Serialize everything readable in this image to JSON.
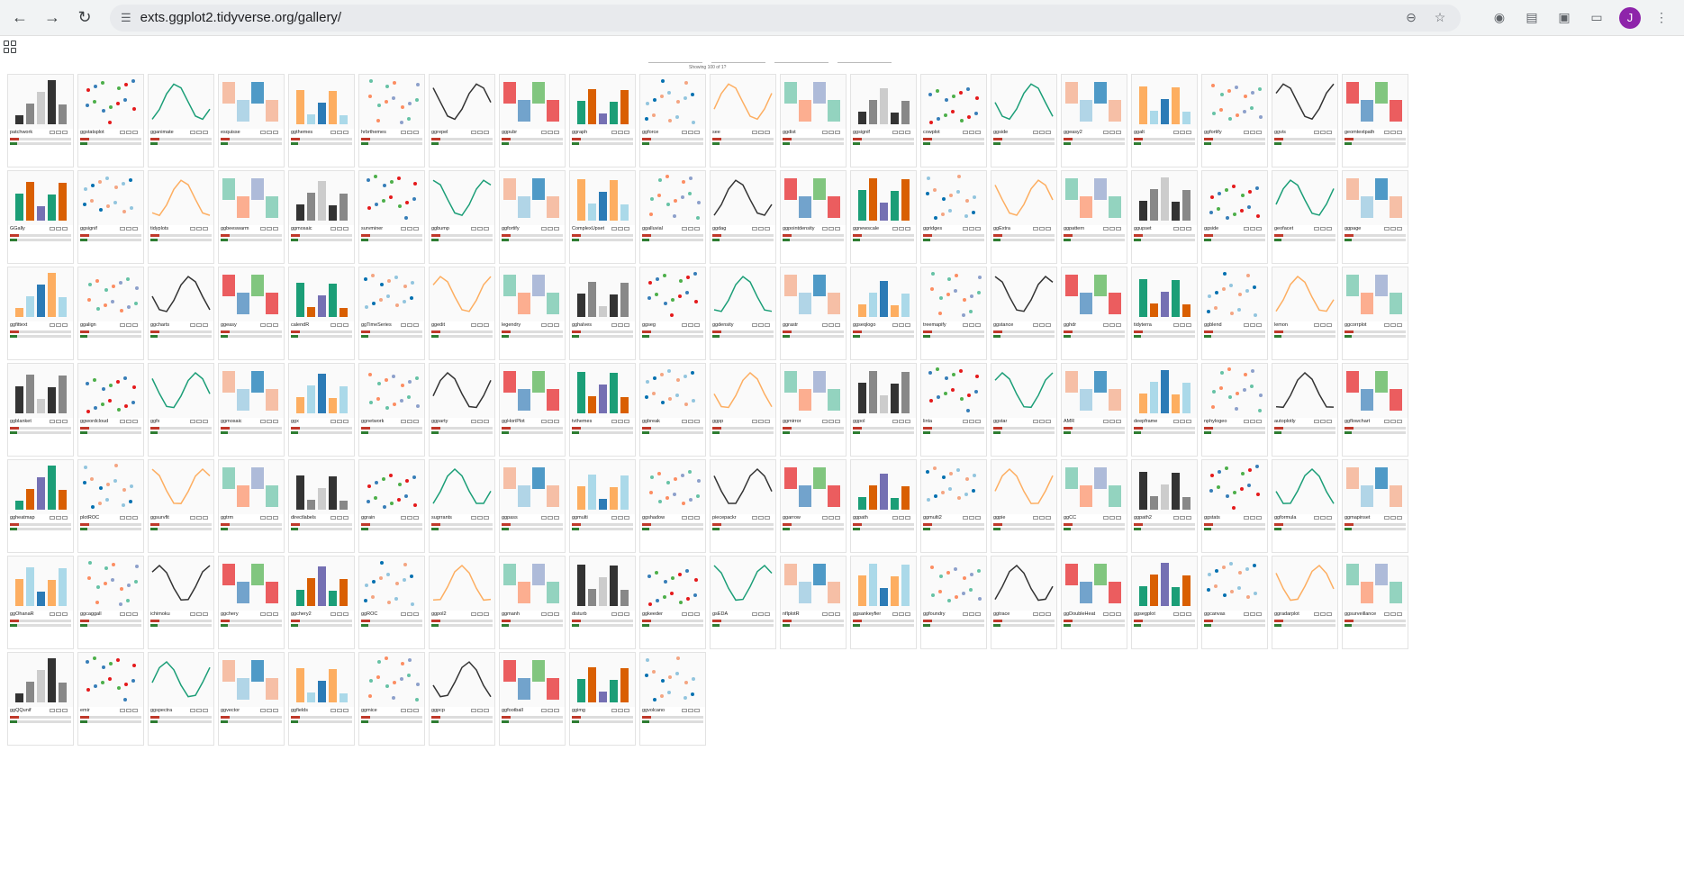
{
  "browser": {
    "url": "exts.ggplot2.tidyverse.org/gallery/",
    "avatar_letter": "J"
  },
  "icons": {
    "back": "arrow-left-icon",
    "forward": "arrow-right-icon",
    "reload": "reload-icon",
    "site_settings": "tune-icon",
    "zoom": "zoom-out-icon",
    "bookmark": "star-icon",
    "apps": "apps-grid-icon"
  },
  "gallery": {
    "showing_text": "Showing 100 of 1?",
    "cards": [
      "patchwork",
      "ggstatsplot",
      "gganimate",
      "esquisse",
      "ggthemes",
      "hrbrthemes",
      "ggrepel",
      "ggpubr",
      "ggraph",
      "ggforce",
      "see",
      "ggdist",
      "ggsignif",
      "cowplot",
      "ggside",
      "ggeasy2",
      "ggalt",
      "ggfortify",
      "ggvis",
      "geomtextpath",
      "GGally",
      "ggsignif",
      "tidyplots",
      "ggbeeswarm",
      "ggmosaic",
      "survminer",
      "ggbump",
      "ggfortify",
      "ComplexUpset",
      "ggalluvial",
      "ggdag",
      "ggpointdensity",
      "ggnewscale",
      "ggridges",
      "ggExtra",
      "ggpattern",
      "ggupset",
      "ggside",
      "geofacet",
      "ggpage",
      "ggfittext",
      "ggalign",
      "ggcharts",
      "ggeasy",
      "calendR",
      "ggTimeSeries",
      "ggedit",
      "legendry",
      "gghalves",
      "ggseg",
      "ggdensity",
      "ggrastr",
      "ggseqlogo",
      "treemapify",
      "ggstance",
      "gghdr",
      "tidyterra",
      "ggblend",
      "lemon",
      "ggcorrplot",
      "ggblanket",
      "ggwordcloud",
      "ggfx",
      "ggmosaic",
      "ggx",
      "ggnetwork",
      "ggparty",
      "ggHoriPlot",
      "tvthemes",
      "ggbreak",
      "ggpp",
      "ggmirror",
      "ggpol",
      "linta",
      "ggstar",
      "AMR",
      "deepframe",
      "nphylogeo",
      "autoplotly",
      "ggflowchart",
      "ggheatmap",
      "plotROC",
      "ggsurvfit",
      "ggtrm",
      "directlabels",
      "ggrain",
      "sugrrants",
      "ggpass",
      "ggmulti",
      "ggshadow",
      "piecepackr",
      "ggarrow",
      "ggpath",
      "ggmulti2",
      "ggpie",
      "ggCC",
      "ggpath2",
      "ggstats",
      "ggformula",
      "ggmapinset",
      "ggOhanaR",
      "ggcaggall",
      "ichimoku",
      "ggchery",
      "ggchery2",
      "ggROC",
      "ggpol2",
      "ggmanh",
      "disturb",
      "ggkeeder",
      "gsEDA",
      "nflplotR",
      "ggsankeyfier",
      "ggfoundry",
      "ggtrace",
      "ggDoubleHeat",
      "ggsegplot",
      "ggcanvas",
      "ggradarplot",
      "ggsurveillance",
      "ggQQunif",
      "emir",
      "ggspectra",
      "ggvector",
      "ggfields",
      "ggmice",
      "ggpcp",
      "ggfootball",
      "ggimg",
      "ggvolcano"
    ]
  }
}
